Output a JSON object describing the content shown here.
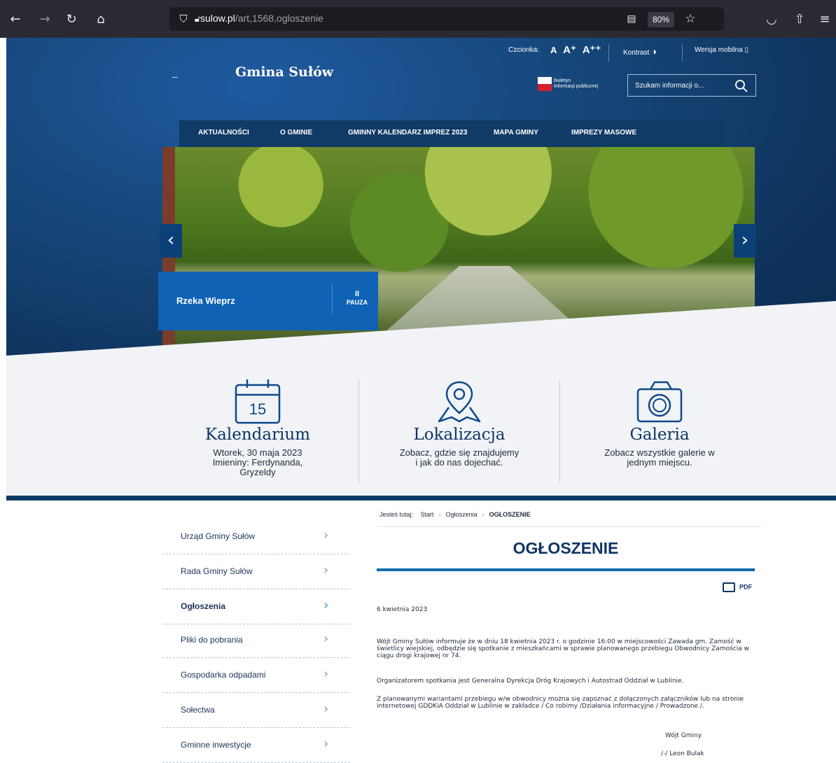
{
  "browser": {
    "url_host": "sulow.pl",
    "url_path": "/art,1568,ogloszenie",
    "zoom": "80%"
  },
  "header": {
    "site_title": "Gmina Sułów",
    "font_label": "Czcionka:",
    "font_sizes": [
      "A",
      "A⁺",
      "A⁺⁺"
    ],
    "contrast_label": "Kontrast",
    "mobile_label": "Wersja mobilna",
    "bip_line1": "biuletyn",
    "bip_line2": "informacji publicznej",
    "search_placeholder": "Szukam informacji o..."
  },
  "nav": {
    "items": [
      "AKTUALNOŚCI",
      "O GMINIE",
      "GMINNY KALENDARZ IMPREZ 2023",
      "MAPA GMINY",
      "IMPREZY MASOWE"
    ]
  },
  "slider": {
    "caption": "Rzeka Wieprz",
    "pause_label": "PAUZA",
    "pause_symbol": "II"
  },
  "features": [
    {
      "title": "Kalendarium",
      "icon_number": "15",
      "line1": "Wtorek, 30 maja 2023",
      "line2": "Imieniny: Ferdynanda,",
      "line3": "Gryzeldy"
    },
    {
      "title": "Lokalizacja",
      "line1": "Zobacz, gdzie się znajdujemy",
      "line2": "i jak do nas dojechać."
    },
    {
      "title": "Galeria",
      "line1": "Zobacz wszystkie galerie w",
      "line2": "jednym miejscu."
    }
  ],
  "sidebar": {
    "items": [
      "Urząd Gminy Sułów",
      "Rada Gminy Sułów",
      "Ogłoszenia",
      "Pliki do pobrania",
      "Gospodarka odpadami",
      "Sołectwa",
      "Gminne inwestycje"
    ],
    "active": "Ogłoszenia"
  },
  "breadcrumb": {
    "prefix": "Jesteś tutaj:",
    "items": [
      "Start",
      "Ogłoszenia",
      "OGŁOSZENIE"
    ]
  },
  "article": {
    "title": "OGŁOSZENIE",
    "pdf_label": "PDF",
    "date": "6 kwietnia 2023",
    "p1": "Wójt Gminy Sułów informuje że w dniu 18 kwietnia 2023 r. o godzinie 16:00 w miejscowości Zawada gm. Zamość w świetlicy wiejskiej, odbędzie się spotkanie z mieszkańcami w sprawie planowanego przebiegu Obwodnicy Zamościa w ciągu drogi krajowej nr 74.",
    "p2": "Organizatorem spotkania jest Generalna Dyrekcja Dróg Krajowych i Autostrad Oddział w Lublinie.",
    "p3": "Z planowanymi wariantami przebiegu w/w obwodnicy można się zapoznać z dołączonych załączników lub na stronie internetowej GDDKiA Oddział w Lublinie w zakładce / Co robimy /Działania informacyjne / Prowadzone /.",
    "sign1": "Wójt Gminy",
    "sign2": "/-/ Leon Bulak"
  }
}
